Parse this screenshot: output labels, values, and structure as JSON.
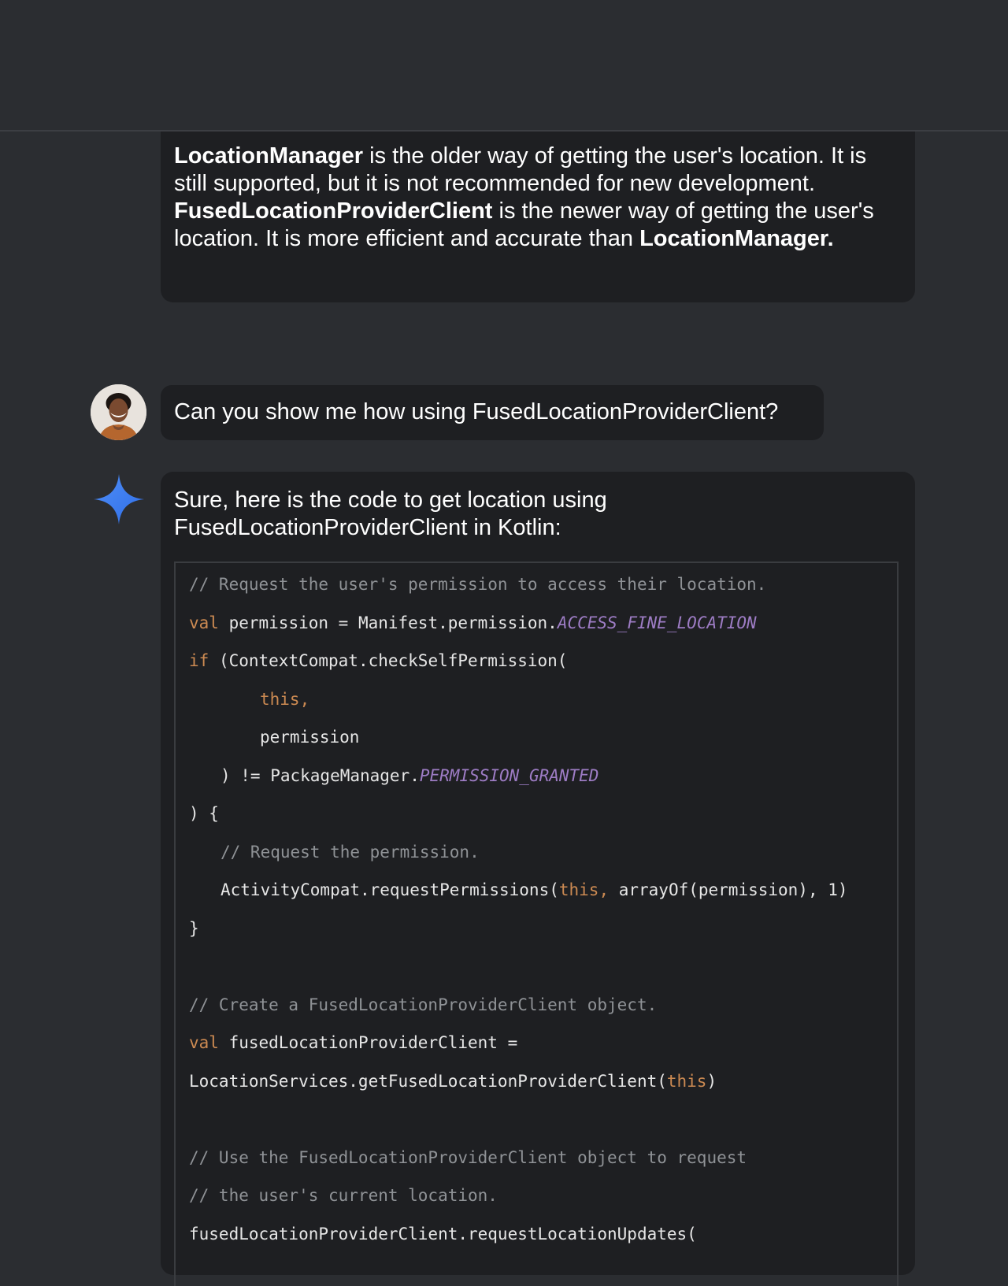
{
  "previous_message": {
    "parts": [
      {
        "text": "LocationManager",
        "bold": true
      },
      {
        "text": " is the older way of getting the user's location. It is still supported, but it is not recommended for new development. ",
        "bold": false
      },
      {
        "text": "FusedLocationProviderClient",
        "bold": true
      },
      {
        "text": " is the newer way of getting the user's location. It is more efficient and accurate than ",
        "bold": false
      },
      {
        "text": "LocationManager.",
        "bold": true
      }
    ]
  },
  "user_message": {
    "text": "Can you show me how using FusedLocationProviderClient?"
  },
  "response": {
    "intro": "Sure, here is the code to get location using FusedLocationProviderClient in Kotlin:",
    "code_lines": [
      {
        "indent": 0,
        "tokens": [
          {
            "t": "// Request the user's permission to access their location.",
            "c": "cm"
          }
        ]
      },
      {
        "indent": 0,
        "tokens": [
          {
            "t": "val",
            "c": "kw"
          },
          {
            "t": " permission = Manifest.permission.",
            "c": ""
          },
          {
            "t": "ACCESS_FINE_LOCATION",
            "c": "cst"
          }
        ]
      },
      {
        "indent": 0,
        "tokens": [
          {
            "t": "if",
            "c": "kw"
          },
          {
            "t": " (ContextCompat.checkSelfPermission(",
            "c": ""
          }
        ]
      },
      {
        "indent": 2,
        "tokens": [
          {
            "t": "this,",
            "c": "kw"
          }
        ]
      },
      {
        "indent": 2,
        "tokens": [
          {
            "t": "permission",
            "c": ""
          }
        ]
      },
      {
        "indent": 1,
        "tokens": [
          {
            "t": ") != PackageManager.",
            "c": ""
          },
          {
            "t": "PERMISSION_GRANTED",
            "c": "cst"
          }
        ]
      },
      {
        "indent": 0,
        "tokens": [
          {
            "t": ") {",
            "c": ""
          }
        ]
      },
      {
        "indent": 1,
        "tokens": [
          {
            "t": "// Request the permission.",
            "c": "cm"
          }
        ]
      },
      {
        "indent": 1,
        "tokens": [
          {
            "t": "ActivityCompat.requestPermissions(",
            "c": ""
          },
          {
            "t": "this,",
            "c": "kw"
          },
          {
            "t": " arrayOf(permission), 1)",
            "c": ""
          }
        ]
      },
      {
        "indent": 0,
        "tokens": [
          {
            "t": "}",
            "c": ""
          }
        ]
      },
      {
        "indent": 0,
        "tokens": []
      },
      {
        "indent": 0,
        "tokens": [
          {
            "t": "// Create a FusedLocationProviderClient object.",
            "c": "cm"
          }
        ]
      },
      {
        "indent": 0,
        "tokens": [
          {
            "t": "val",
            "c": "kw"
          },
          {
            "t": " fusedLocationProviderClient =",
            "c": ""
          }
        ]
      },
      {
        "indent": 0,
        "tokens": [
          {
            "t": "LocationServices.getFusedLocationProviderClient(",
            "c": ""
          },
          {
            "t": "this",
            "c": "kw"
          },
          {
            "t": ")",
            "c": ""
          }
        ]
      },
      {
        "indent": 0,
        "tokens": []
      },
      {
        "indent": 0,
        "tokens": [
          {
            "t": "// Use the FusedLocationProviderClient object to request",
            "c": "cm"
          }
        ]
      },
      {
        "indent": 0,
        "tokens": [
          {
            "t": "// the user's current location.",
            "c": "cm"
          }
        ]
      },
      {
        "indent": 0,
        "tokens": [
          {
            "t": "fusedLocationProviderClient.requestLocationUpdates(",
            "c": ""
          }
        ]
      }
    ]
  },
  "icons": {
    "user_avatar": "user-avatar",
    "assistant": "sparkle-icon"
  },
  "colors": {
    "background": "#2b2d31",
    "bubble": "#1e1f22",
    "text": "#ffffff",
    "comment": "#8f9296",
    "keyword": "#cc8a52",
    "constant": "#9d7cc4",
    "sparkle": "#3b82f6"
  }
}
